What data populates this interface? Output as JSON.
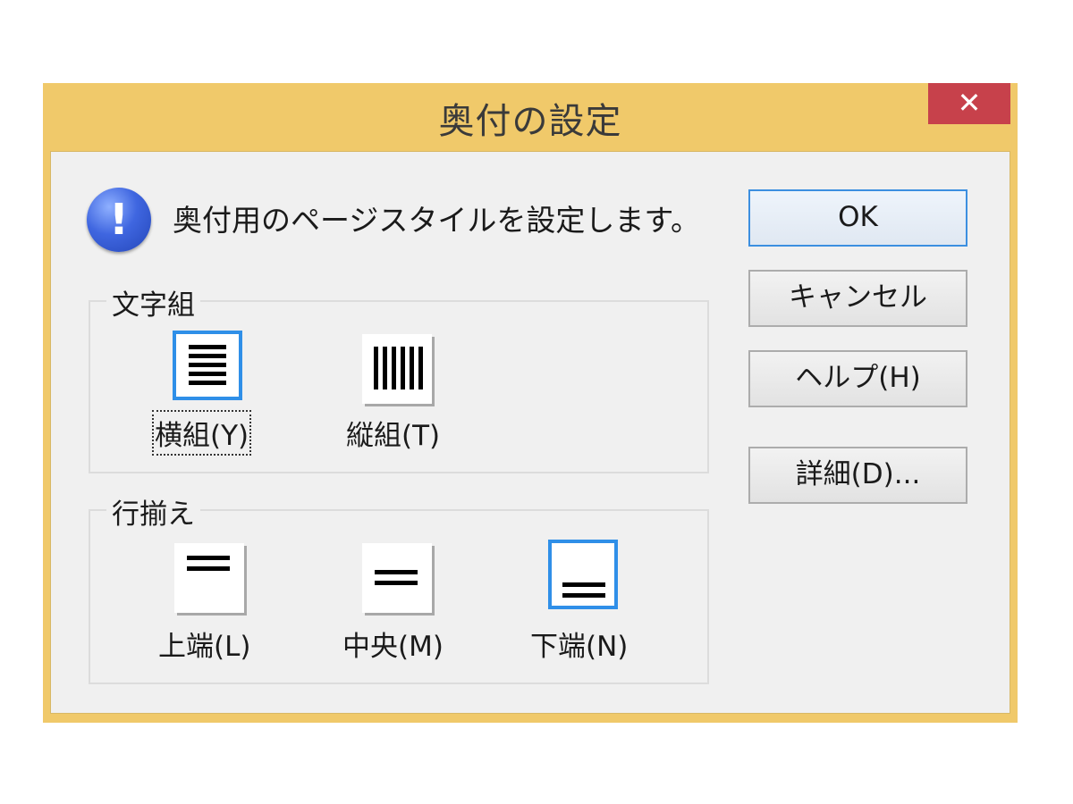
{
  "window": {
    "title": "奥付の設定",
    "close_glyph": "✕"
  },
  "message": {
    "icon": "info-exclamation-icon",
    "icon_glyph": "!",
    "text": "奥付用のページスタイルを設定します。"
  },
  "text_direction": {
    "label": "文字組",
    "options": [
      {
        "label": "横組(Y)",
        "icon": "horizontal-text-icon",
        "selected": true,
        "focused": true
      },
      {
        "label": "縦組(T)",
        "icon": "vertical-text-icon",
        "selected": false,
        "focused": false
      }
    ]
  },
  "alignment": {
    "label": "行揃え",
    "options": [
      {
        "label": "上端(L)",
        "icon": "align-top-icon",
        "selected": false
      },
      {
        "label": "中央(M)",
        "icon": "align-middle-icon",
        "selected": false
      },
      {
        "label": "下端(N)",
        "icon": "align-bottom-icon",
        "selected": true
      }
    ]
  },
  "buttons": {
    "ok": "OK",
    "cancel": "キャンセル",
    "help": "ヘルプ(H)",
    "details": "詳細(D)..."
  },
  "colors": {
    "title_bar": "#f0c96a",
    "close_button": "#c7414b",
    "selection_border": "#2f8fe8"
  }
}
